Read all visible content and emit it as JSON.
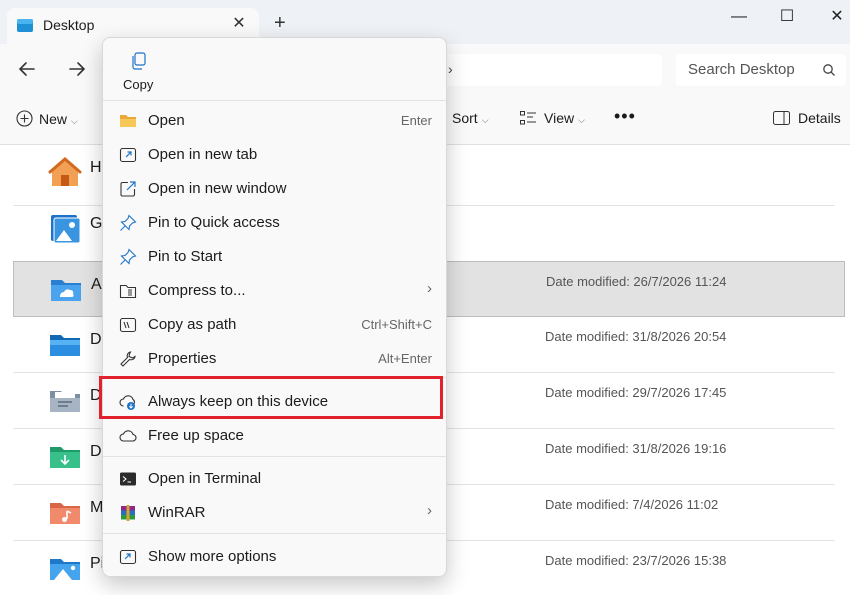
{
  "window": {
    "tab_title": "Desktop",
    "tab_close": "✕",
    "new_tab": "+",
    "minimize": "—",
    "maximize": "☐",
    "close": "✕"
  },
  "address": {
    "crumb_chevron": "›",
    "search_placeholder": "Search Desktop"
  },
  "commandbar": {
    "new_label": "New",
    "sort_label": "Sort",
    "view_label": "View",
    "more_label": "•••",
    "details_label": "Details"
  },
  "files": [
    {
      "name_visible": "H",
      "date": "",
      "icon": "home-icon",
      "selected": false
    },
    {
      "name_visible": "G",
      "date": "",
      "icon": "gallery-icon",
      "selected": false
    },
    {
      "name_visible": "A",
      "date": "Date modified: 26/7/2026 11:24",
      "icon": "cloud-folder-icon",
      "selected": true
    },
    {
      "name_visible": "D",
      "date": "Date modified: 31/8/2026 20:54",
      "icon": "desktop-folder-icon",
      "selected": false
    },
    {
      "name_visible": "D",
      "date": "Date modified: 29/7/2026 17:45",
      "icon": "documents-folder-icon",
      "selected": false
    },
    {
      "name_visible": "D",
      "date": "Date modified: 31/8/2026 19:16",
      "icon": "downloads-folder-icon",
      "selected": false
    },
    {
      "name_visible": "M",
      "date": "Date modified: 7/4/2026 11:02",
      "icon": "music-folder-icon",
      "selected": false
    },
    {
      "name_visible": "Pi",
      "date": "Date modified: 23/7/2026 15:38",
      "icon": "pictures-folder-icon",
      "selected": false
    }
  ],
  "context_menu": {
    "copy_label": "Copy",
    "items": [
      {
        "label": "Open",
        "shortcut": "Enter",
        "icon": "folder-icon"
      },
      {
        "label": "Open in new tab",
        "shortcut": "",
        "icon": "new-tab-icon"
      },
      {
        "label": "Open in new window",
        "shortcut": "",
        "icon": "new-window-icon"
      },
      {
        "label": "Pin to Quick access",
        "shortcut": "",
        "icon": "pin-icon"
      },
      {
        "label": "Pin to Start",
        "shortcut": "",
        "icon": "pin-icon"
      },
      {
        "label": "Compress to...",
        "shortcut": "›",
        "icon": "zip-folder-icon"
      },
      {
        "label": "Copy as path",
        "shortcut": "Ctrl+Shift+C",
        "icon": "copy-path-icon"
      },
      {
        "label": "Properties",
        "shortcut": "Alt+Enter",
        "icon": "wrench-icon"
      },
      {
        "label": "Always keep on this device",
        "shortcut": "",
        "icon": "cloud-download-icon"
      },
      {
        "label": "Free up space",
        "shortcut": "",
        "icon": "cloud-icon"
      },
      {
        "label": "Open in Terminal",
        "shortcut": "",
        "icon": "terminal-icon"
      },
      {
        "label": "WinRAR",
        "shortcut": "›",
        "icon": "winrar-icon"
      },
      {
        "label": "Show more options",
        "shortcut": "",
        "icon": "more-options-icon"
      }
    ]
  },
  "colors": {
    "highlight_border": "#e1222d",
    "accent_blue": "#1e73c8",
    "folder_yellow": "#f2c14e"
  }
}
